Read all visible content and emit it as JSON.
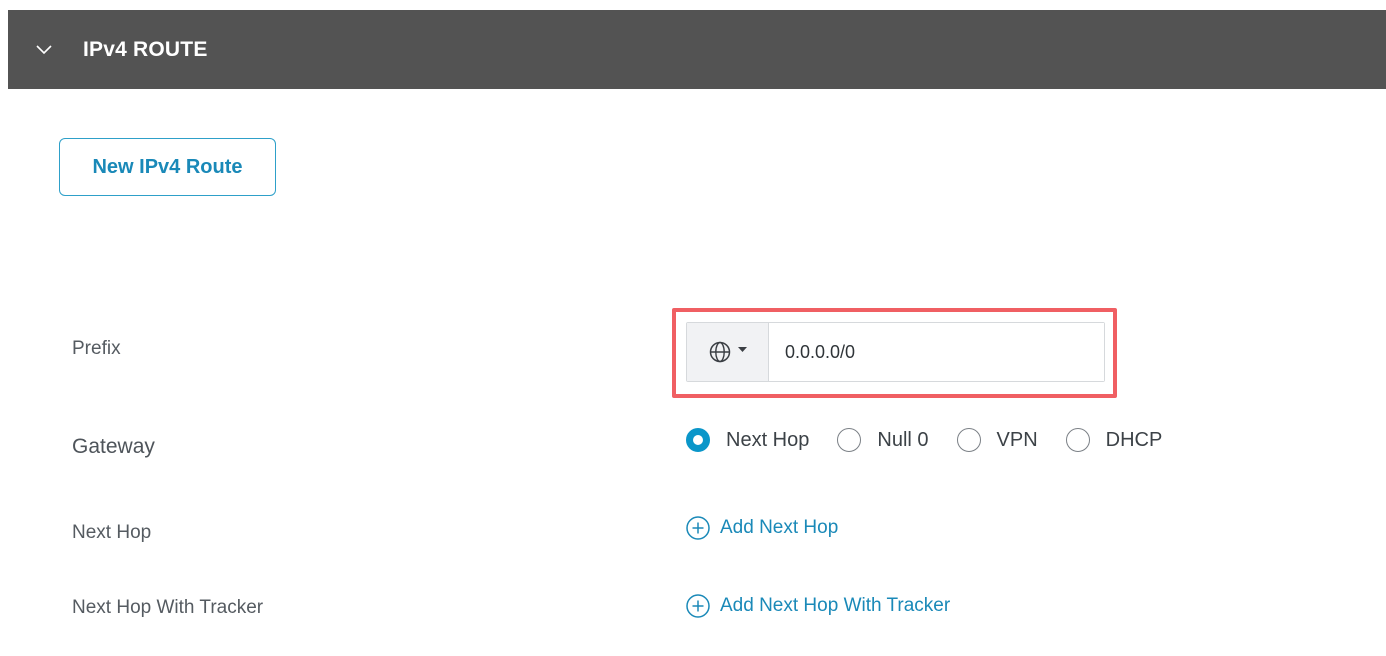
{
  "section": {
    "title": "IPv4 ROUTE",
    "toggle_icon": "chevron-down-icon"
  },
  "new_route_button": "New IPv4 Route",
  "prefix": {
    "label": "Prefix",
    "selector_icon": "globe-icon",
    "value": "0.0.0.0/0"
  },
  "gateway": {
    "label": "Gateway",
    "options": [
      {
        "label": "Next Hop",
        "checked": true
      },
      {
        "label": "Null 0",
        "checked": false
      },
      {
        "label": "VPN",
        "checked": false
      },
      {
        "label": "DHCP",
        "checked": false
      }
    ]
  },
  "next_hop": {
    "label": "Next Hop",
    "link": "Add Next Hop"
  },
  "next_hop_tracker": {
    "label": "Next Hop With Tracker",
    "link": "Add Next Hop With Tracker"
  },
  "colors": {
    "header_bg": "#535353",
    "accent": "#1a89b8",
    "radio_checked": "#0a96c9",
    "highlight": "#f05f63"
  }
}
